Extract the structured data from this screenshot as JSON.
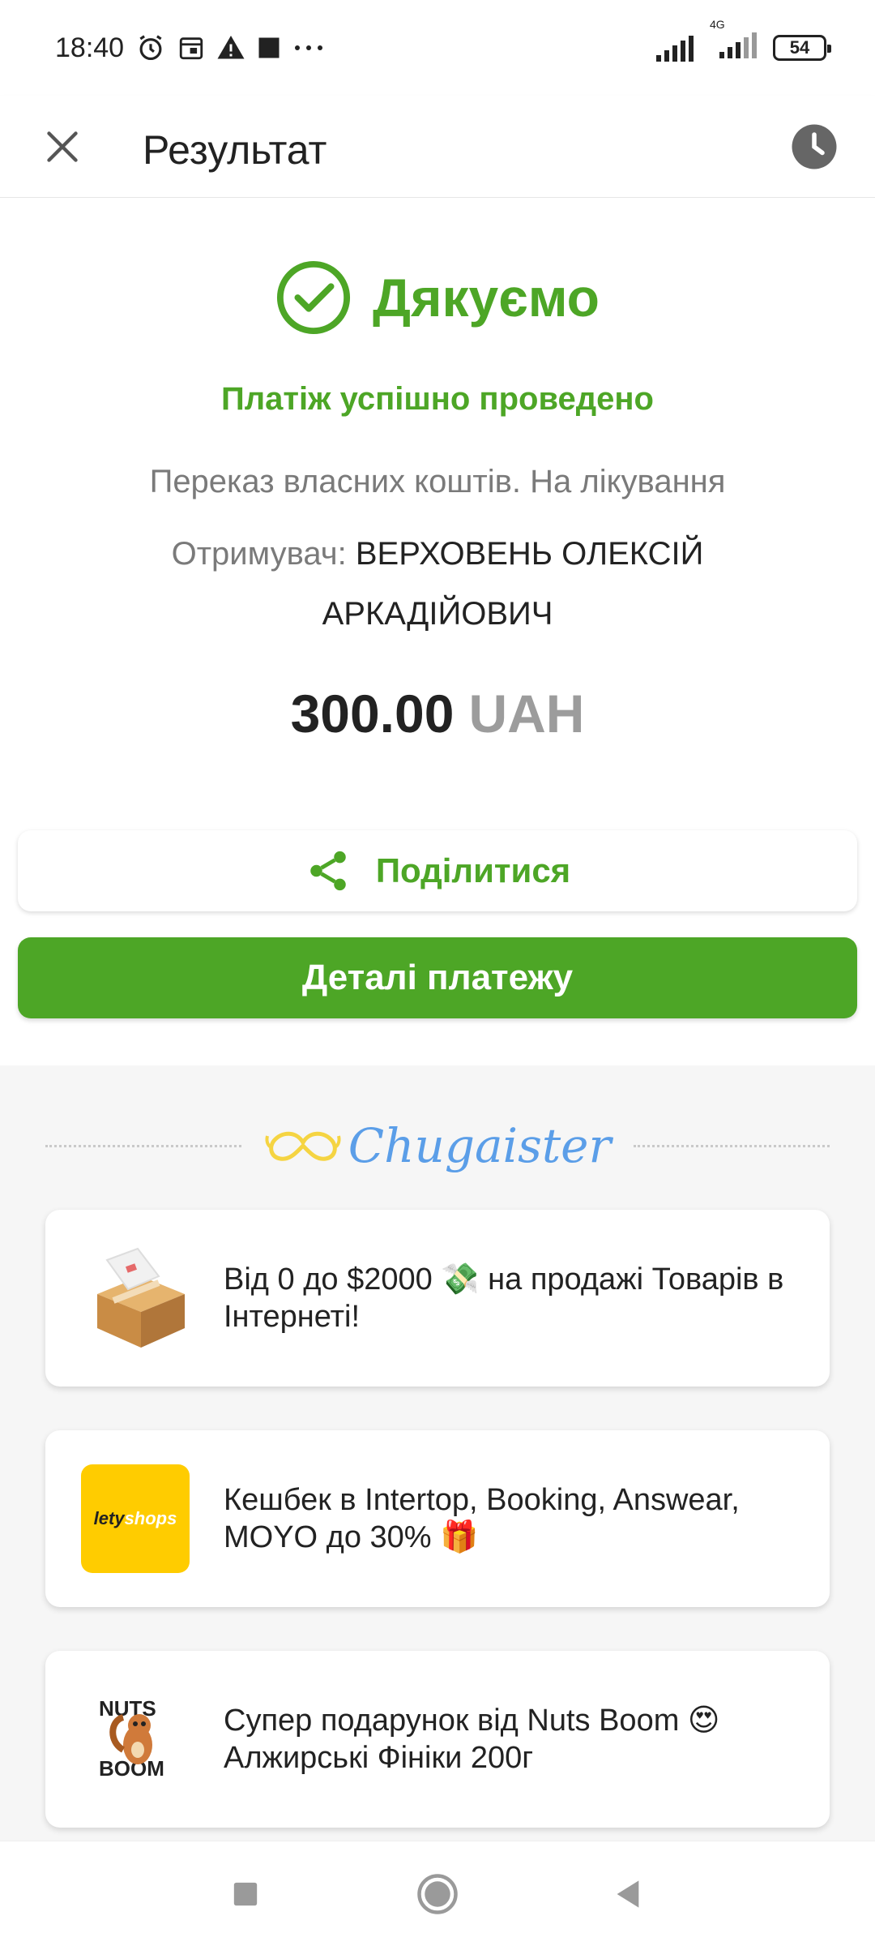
{
  "status_bar": {
    "time": "18:40",
    "icons": [
      "alarm-icon",
      "calendar-icon",
      "warning-icon",
      "stop-icon",
      "more-icon"
    ],
    "network": "4G",
    "battery": "54"
  },
  "app_bar": {
    "title": "Результат",
    "close_icon": "close-icon",
    "history_icon": "clock-icon"
  },
  "result": {
    "title": "Дякуємо",
    "success_message": "Платіж успішно проведено",
    "purpose": "Переказ власних коштів. На лікування",
    "recipient_label": "Отримувач:",
    "recipient_name": "ВЕРХОВЕНЬ ОЛЕКСІЙ АРКАДІЙОВИЧ",
    "amount": "300.00",
    "currency": "UAH"
  },
  "actions": {
    "share_label": "Поділитися",
    "details_label": "Деталі платежу"
  },
  "promo": {
    "brand": "Chugaister",
    "cards": [
      {
        "text": "Від 0 до $2000 💸 на продажі Товарів в Інтернеті!",
        "thumb": "package-icon"
      },
      {
        "text": "Кешбек в Intertop, Booking, Answear, MOYO до 30% 🎁",
        "thumb_text_a": "lety",
        "thumb_text_b": "shops"
      },
      {
        "text": "Супер подарунок від Nuts Boom 😍 Алжирські Фініки 200г",
        "thumb_text_a": "NUTS",
        "thumb_text_b": "BOOM"
      }
    ]
  },
  "colors": {
    "accent": "#4da626",
    "muted": "#7a7a7a",
    "currency": "#9c9c9c",
    "chug_blue": "#5b9ee8",
    "chug_yellow": "#f5d442",
    "lety_yellow": "#ffcc00"
  }
}
